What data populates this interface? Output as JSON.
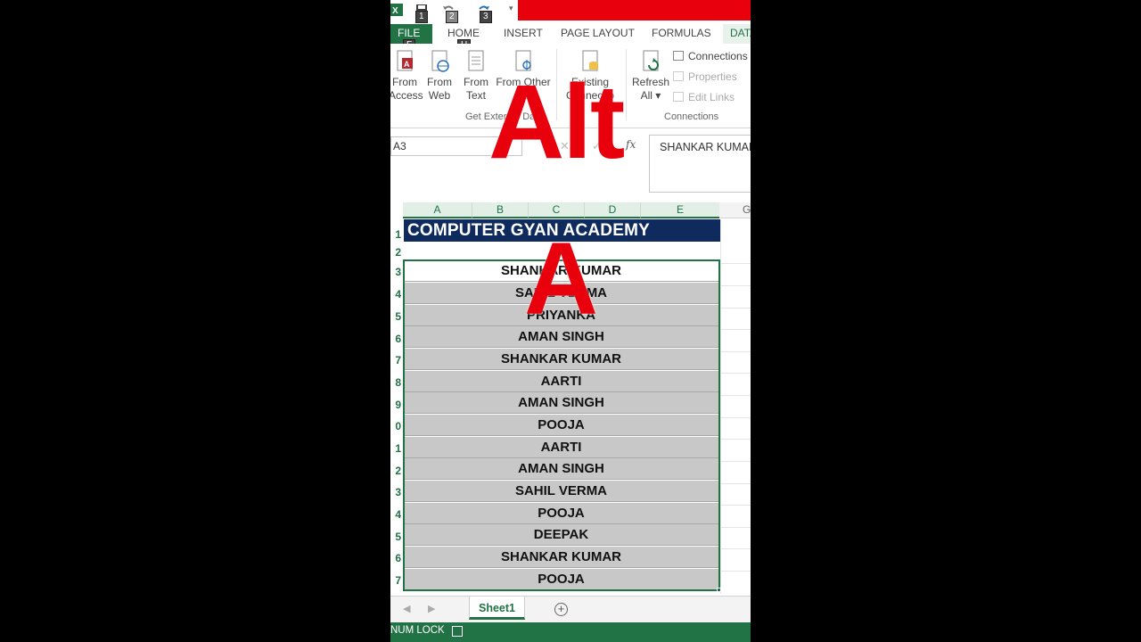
{
  "qat": {
    "keytips": [
      "1",
      "2",
      "3"
    ]
  },
  "ribbon_tabs": {
    "file": "FILE",
    "home": "HOME",
    "insert": "INSERT",
    "page_layout": "PAGE LAYOUT",
    "formulas": "FORMULAS",
    "data": "DATA",
    "file_keytip": "F",
    "home_keytip": "H"
  },
  "ribbon": {
    "get_external": {
      "from_access": [
        "From",
        "Access"
      ],
      "from_web": [
        "From",
        "Web"
      ],
      "from_text": [
        "From",
        "Text"
      ],
      "from_other": [
        "From Other",
        "So"
      ],
      "existing": [
        "Existing",
        "Connectio"
      ],
      "group_label": "Get External Da"
    },
    "connections": {
      "refresh": [
        "Refresh",
        "All ▾"
      ],
      "connections": "Connections",
      "properties": "Properties",
      "edit_links": "Edit Links",
      "group_label": "Connections"
    }
  },
  "formula_bar": {
    "name_box": "A3",
    "fx": "fx",
    "value": "SHANKAR KUMAR"
  },
  "columns": [
    "A",
    "B",
    "C",
    "D",
    "E"
  ],
  "next_column": "G",
  "rows": {
    "numbers": [
      "1",
      "2",
      "3",
      "4",
      "5",
      "6",
      "7",
      "8",
      "9",
      "0",
      "1",
      "2",
      "3",
      "4",
      "5",
      "6",
      "7"
    ],
    "banner": "COMPUTER GYAN ACADEMY",
    "names": [
      "SHANKAR KUMAR",
      "SAHIL VERMA",
      "PRIYANKA",
      "AMAN SINGH",
      "SHANKAR KUMAR",
      "AARTI",
      "AMAN SINGH",
      "POOJA",
      "AARTI",
      "AMAN SINGH",
      "SAHIL VERMA",
      "POOJA",
      "DEEPAK",
      "SHANKAR KUMAR",
      "POOJA"
    ]
  },
  "sheet_tabs": {
    "active": "Sheet1",
    "add": "+"
  },
  "status_bar": {
    "text": "NUM LOCK"
  },
  "overlay": {
    "big": "Alt",
    "small": "A"
  },
  "colors": {
    "excel_green": "#217346",
    "banner_navy": "#0f2a5c",
    "overlay_red": "#e8000d"
  }
}
